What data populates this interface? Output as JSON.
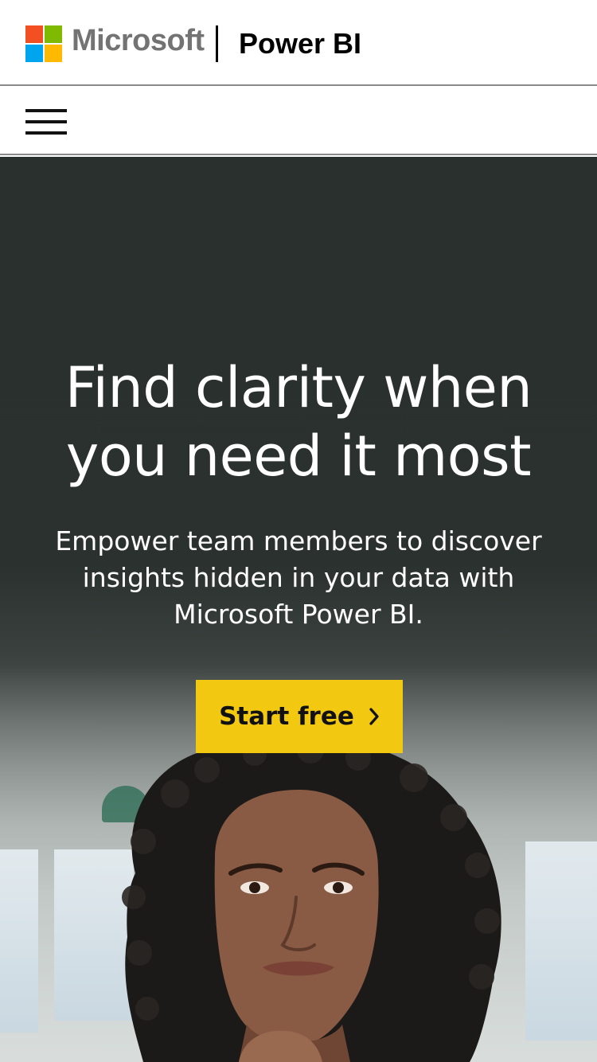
{
  "header": {
    "brand_company": "Microsoft",
    "brand_product": "Power BI",
    "logo_colors": [
      "#f25022",
      "#7fba00",
      "#00a4ef",
      "#ffb900"
    ]
  },
  "navbar": {
    "menu_icon": "hamburger-menu-icon"
  },
  "hero": {
    "title": "Find clarity when you need it most",
    "subtitle": "Empower team members to discover insights hidden in your data with Microsoft Power BI.",
    "cta_label": "Start free",
    "cta_icon": "chevron-right-icon",
    "cta_color": "#f2c811",
    "background_color": "#2b312e",
    "image": "woman-portrait-photo"
  }
}
